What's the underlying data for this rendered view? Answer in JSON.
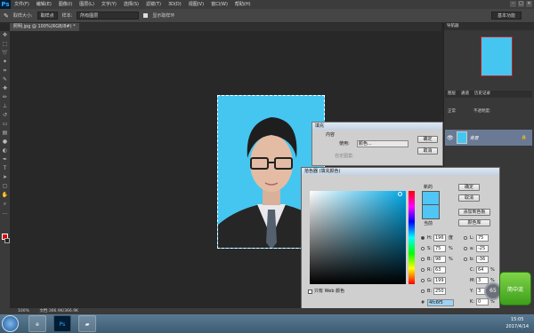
{
  "menubar": {
    "logo": "Ps",
    "items": [
      "文件(F)",
      "编辑(E)",
      "图像(I)",
      "图层(L)",
      "文字(Y)",
      "选择(S)",
      "滤镜(T)",
      "3D(D)",
      "视图(V)",
      "窗口(W)",
      "帮助(H)"
    ]
  },
  "options": {
    "size_label": "取样大小:",
    "size_value": "取样点",
    "sample_label": "样本:",
    "sample_value": "所有图层",
    "show_ring": "显示取样环",
    "workspace": "基本功能"
  },
  "document": {
    "tab": "照明.jpg @ 100%(RGB/8#) *"
  },
  "panels": {
    "navigator": "导航器",
    "layers_tabs": [
      "图层",
      "通道",
      "历史记录"
    ],
    "mode": "正常",
    "opacity_label": "不透明度:",
    "layer_name": "背景"
  },
  "fill_dialog": {
    "title": "填充",
    "contents_label": "内容",
    "use_label": "使用:",
    "use_value": "颜色...",
    "pattern_label": "自定图案:",
    "ok": "确定",
    "cancel": "取消"
  },
  "color_picker": {
    "title": "拾色器 (填充颜色)",
    "new_label": "新的",
    "current_label": "当前",
    "ok": "确定",
    "cancel": "取消",
    "add_swatch": "添加到色板",
    "libraries": "颜色库",
    "web_only": "只有 Web 颜色",
    "hex_prefix": "#",
    "hex": "4fc6f5",
    "fields": {
      "H": {
        "label": "H:",
        "value": "196",
        "unit": "度"
      },
      "S": {
        "label": "S:",
        "value": "75",
        "unit": "%"
      },
      "B": {
        "label": "B:",
        "value": "98",
        "unit": "%"
      },
      "R": {
        "label": "R:",
        "value": "63"
      },
      "G": {
        "label": "G:",
        "value": "199"
      },
      "Bl": {
        "label": "B:",
        "value": "250"
      },
      "L": {
        "label": "L:",
        "value": "75"
      },
      "a": {
        "label": "a:",
        "value": "-25"
      },
      "b": {
        "label": "b:",
        "value": "-36"
      },
      "C": {
        "label": "C:",
        "value": "64",
        "unit": "%"
      },
      "M": {
        "label": "M:",
        "value": "3",
        "unit": "%"
      },
      "Y": {
        "label": "Y:",
        "value": "3",
        "unit": "%"
      },
      "K": {
        "label": "K:",
        "value": "0",
        "unit": "%"
      }
    }
  },
  "status": {
    "zoom": "100%",
    "doc": "文档:366.9K/366.9K"
  },
  "taskbar": {
    "time": "15:05",
    "date": "2017/4/14"
  },
  "widget": {
    "gauge": "65",
    "label": "简中流"
  }
}
